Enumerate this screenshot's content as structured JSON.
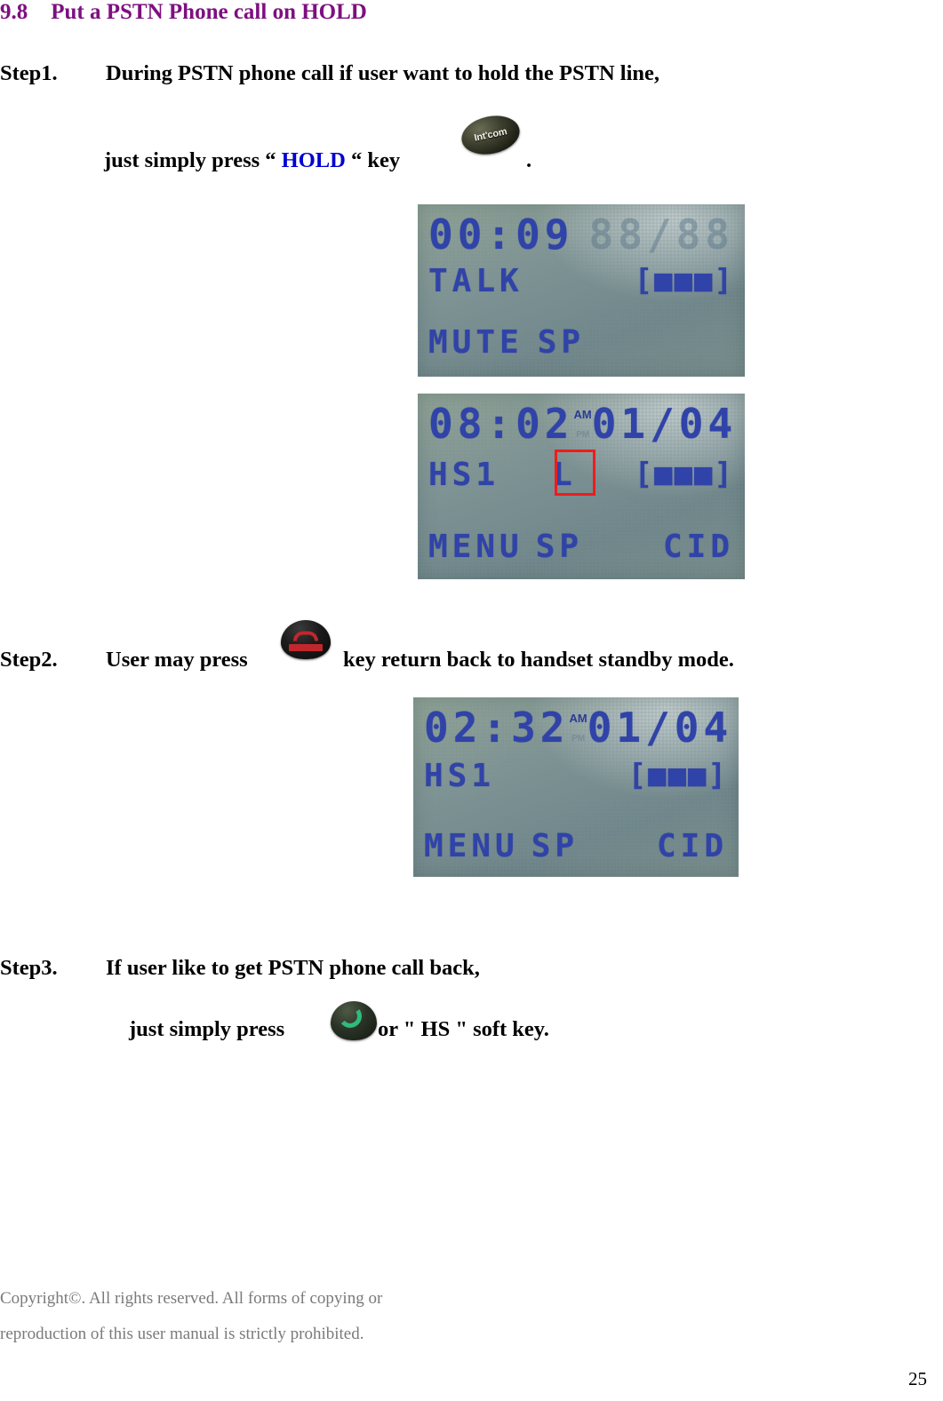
{
  "heading": {
    "number": "9.8",
    "title": "Put a PSTN Phone call on HOLD",
    "color": "#7D1080"
  },
  "steps": [
    {
      "label": "Step1.",
      "line1": "During PSTN phone call if user want to hold the PSTN line,",
      "line2_prefix": "just simply press “ ",
      "line2_keyword": "HOLD",
      "line2_suffix": " “ key",
      "line2_end": ".",
      "keyword_color": "#0000D2",
      "icon": "intcom-key-icon",
      "icon_label": "Int'com"
    },
    {
      "label": "Step2.",
      "line1_prefix": "User may press",
      "line1_suffix": "key return back to handset standby mode.",
      "icon": "end-call-key-icon"
    },
    {
      "label": "Step3.",
      "line1": "If user like to get PSTN phone call back,",
      "line2_prefix": "just simply press",
      "line2_suffix": "or \" HS \" soft key.",
      "icon": "talk-key-icon"
    }
  ],
  "lcd_screens": [
    {
      "name": "lcd-talk-screen",
      "time": "00:09",
      "date": "88/88",
      "date_faint": true,
      "ampm": "",
      "line2_left": "TALK",
      "line2_right": "[■■■]",
      "line4_left": "MUTE",
      "line4_mid": "SP",
      "line4_right": "",
      "highlight": null
    },
    {
      "name": "lcd-hold-screen",
      "time": "08:02",
      "date": "01/04",
      "date_faint": false,
      "ampm": "AM",
      "ampm_secondary": "PM",
      "line2_left": "HS1",
      "line2_mid": "L",
      "line2_right": "[■■■]",
      "line4_left": "MENU",
      "line4_mid": "SP",
      "line4_right": "CID",
      "highlight": "L"
    },
    {
      "name": "lcd-standby-screen",
      "time": "02:32",
      "date": "01/04",
      "date_faint": false,
      "ampm": "AM",
      "ampm_secondary": "PM",
      "line2_left": "HS1",
      "line2_mid": "",
      "line2_right": "[■■■]",
      "line4_left": "MENU",
      "line4_mid": "SP",
      "line4_right": "CID",
      "highlight": null
    }
  ],
  "footer": {
    "line1": "Copyright©. All rights reserved. All forms of copying or",
    "line2": "reproduction of this user manual is strictly prohibited.",
    "page_number": "25"
  }
}
